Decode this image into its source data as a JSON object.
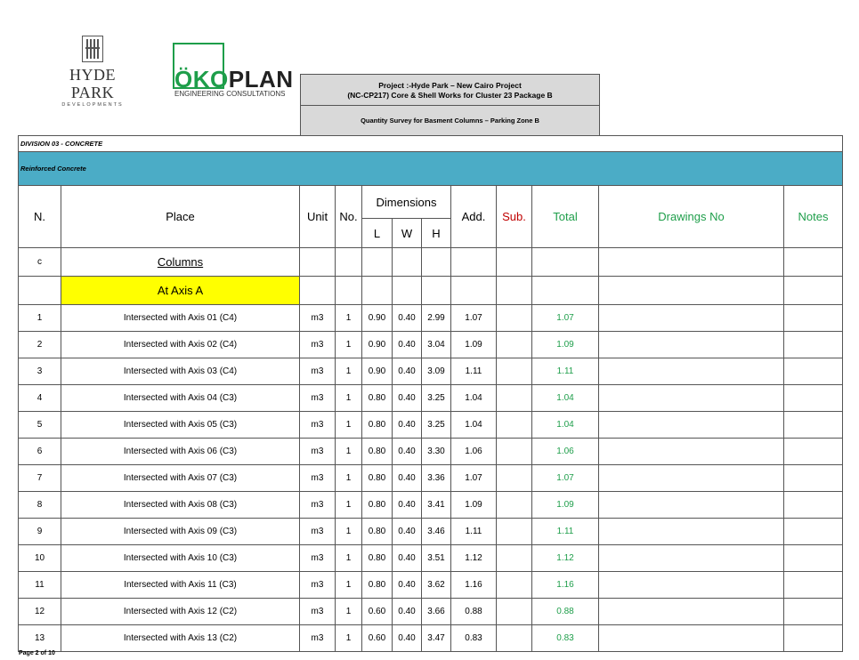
{
  "logos": {
    "hyde_park": {
      "name": "HYDE PARK",
      "sub": "DEVELOPMENTS"
    },
    "okoplan": {
      "name_green": "ÖKO",
      "name_dark": "PLAN",
      "sub": "ENGINEERING CONSULTATIONS"
    }
  },
  "project": {
    "line1": "Project :-Hyde Park – New Cairo Project",
    "line2": "(NC-CP217) Core & Shell Works for Cluster 23 Package B",
    "survey": "Quantity Survey for Basment Columns – Parking Zone B"
  },
  "division": "DIVISION 03 - CONCRETE",
  "category": "Reinforced Concrete",
  "headers": {
    "n": "N.",
    "place": "Place",
    "unit": "Unit",
    "no": "No.",
    "dimensions": "Dimensions",
    "l": "L",
    "w": "W",
    "h": "H",
    "add": "Add.",
    "sub": "Sub.",
    "total": "Total",
    "drawings": "Drawings No",
    "notes": "Notes"
  },
  "section": {
    "n": "c",
    "label": "Columns"
  },
  "axis_label": "At Axis A",
  "rows": [
    {
      "n": "1",
      "place": "Intersected with Axis 01 (C4)",
      "unit": "m3",
      "no": "1",
      "l": "0.90",
      "w": "0.40",
      "h": "2.99",
      "add": "1.07",
      "total": "1.07"
    },
    {
      "n": "2",
      "place": "Intersected with Axis 02 (C4)",
      "unit": "m3",
      "no": "1",
      "l": "0.90",
      "w": "0.40",
      "h": "3.04",
      "add": "1.09",
      "total": "1.09"
    },
    {
      "n": "3",
      "place": "Intersected with Axis 03 (C4)",
      "unit": "m3",
      "no": "1",
      "l": "0.90",
      "w": "0.40",
      "h": "3.09",
      "add": "1.11",
      "total": "1.11"
    },
    {
      "n": "4",
      "place": "Intersected with Axis 04 (C3)",
      "unit": "m3",
      "no": "1",
      "l": "0.80",
      "w": "0.40",
      "h": "3.25",
      "add": "1.04",
      "total": "1.04"
    },
    {
      "n": "5",
      "place": "Intersected with Axis 05 (C3)",
      "unit": "m3",
      "no": "1",
      "l": "0.80",
      "w": "0.40",
      "h": "3.25",
      "add": "1.04",
      "total": "1.04"
    },
    {
      "n": "6",
      "place": "Intersected with Axis 06 (C3)",
      "unit": "m3",
      "no": "1",
      "l": "0.80",
      "w": "0.40",
      "h": "3.30",
      "add": "1.06",
      "total": "1.06"
    },
    {
      "n": "7",
      "place": "Intersected with Axis 07 (C3)",
      "unit": "m3",
      "no": "1",
      "l": "0.80",
      "w": "0.40",
      "h": "3.36",
      "add": "1.07",
      "total": "1.07"
    },
    {
      "n": "8",
      "place": "Intersected with Axis 08 (C3)",
      "unit": "m3",
      "no": "1",
      "l": "0.80",
      "w": "0.40",
      "h": "3.41",
      "add": "1.09",
      "total": "1.09"
    },
    {
      "n": "9",
      "place": "Intersected with Axis 09 (C3)",
      "unit": "m3",
      "no": "1",
      "l": "0.80",
      "w": "0.40",
      "h": "3.46",
      "add": "1.11",
      "total": "1.11"
    },
    {
      "n": "10",
      "place": "Intersected with Axis 10 (C3)",
      "unit": "m3",
      "no": "1",
      "l": "0.80",
      "w": "0.40",
      "h": "3.51",
      "add": "1.12",
      "total": "1.12"
    },
    {
      "n": "11",
      "place": "Intersected with Axis 11 (C3)",
      "unit": "m3",
      "no": "1",
      "l": "0.80",
      "w": "0.40",
      "h": "3.62",
      "add": "1.16",
      "total": "1.16"
    },
    {
      "n": "12",
      "place": "Intersected with Axis 12 (C2)",
      "unit": "m3",
      "no": "1",
      "l": "0.60",
      "w": "0.40",
      "h": "3.66",
      "add": "0.88",
      "total": "0.88"
    },
    {
      "n": "13",
      "place": "Intersected with Axis 13 (C2)",
      "unit": "m3",
      "no": "1",
      "l": "0.60",
      "w": "0.40",
      "h": "3.47",
      "add": "0.83",
      "total": "0.83"
    }
  ],
  "footer": "Page 2 of 10",
  "colors": {
    "accent_green": "#1e9e4a",
    "sub_red": "#c00000",
    "category_blue": "#4bacc6",
    "highlight_yellow": "#ffff00",
    "header_grey": "#d9d9d9"
  }
}
